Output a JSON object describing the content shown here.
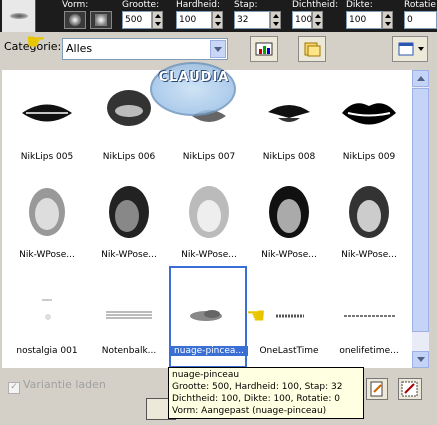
{
  "toolbar": {
    "shape_label": "Vorm:",
    "size_label": "Grootte:",
    "size_value": "500",
    "hardness_label": "Hardheid:",
    "hardness_value": "100",
    "step_label": "Stap:",
    "step_value": "32",
    "density_label": "Dichtheid:",
    "density_value": "100",
    "thickness_label": "Dikte:",
    "thickness_value": "100",
    "rotation_label": "Rotatie:",
    "rotation_value": "0"
  },
  "category": {
    "label": "Categorie:",
    "value": "Alles"
  },
  "watermark": "CLAUDIA",
  "grid_items": [
    [
      "NikLips 005",
      "NikLips 006",
      "NikLips 007",
      "NikLips 008",
      "NikLips 009"
    ],
    [
      "Nik-WPose...",
      "Nik-WPose...",
      "Nik-WPose...",
      "Nik-WPose...",
      "Nik-WPose..."
    ],
    [
      "nostalgia 001",
      "Notenbalk...",
      "nuage-pincea...",
      "OneLastTime",
      "onelifetime..."
    ]
  ],
  "selected_item": "nuage-pinceau",
  "bottom": {
    "variant_label": "Variantie laden"
  },
  "tooltip": {
    "line1": "nuage-pinceau",
    "line2": "Grootte: 500, Hardheid: 100, Stap: 32",
    "line3": "Dichtheid: 100, Dikte: 100, Rotatie: 0",
    "line4": "Vorm: Aangepast (nuage-pinceau)"
  },
  "colors": {
    "selection": "#3a6fd6",
    "tooltip_bg": "#ffffe1",
    "toolbar_bg": "#1c1c1c"
  }
}
